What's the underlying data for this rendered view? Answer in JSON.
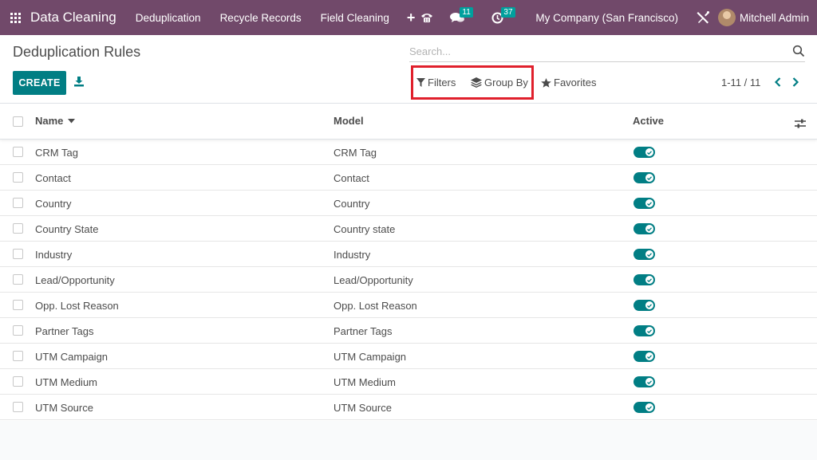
{
  "navbar": {
    "app_title": "Data Cleaning",
    "menu": [
      "Deduplication",
      "Recycle Records",
      "Field Cleaning"
    ],
    "plus_label": "+",
    "messages_count": "11",
    "activities_count": "37",
    "company": "My Company (San Francisco)",
    "user": "Mitchell Admin"
  },
  "control_panel": {
    "title": "Deduplication Rules",
    "search_placeholder": "Search...",
    "create_label": "CREATE",
    "filters_label": "Filters",
    "groupby_label": "Group By",
    "favorites_label": "Favorites",
    "pager": "1-11 / 11"
  },
  "table": {
    "columns": [
      "Name",
      "Model",
      "Active"
    ],
    "rows": [
      {
        "name": "CRM Tag",
        "model": "CRM Tag",
        "active": true
      },
      {
        "name": "Contact",
        "model": "Contact",
        "active": true
      },
      {
        "name": "Country",
        "model": "Country",
        "active": true
      },
      {
        "name": "Country State",
        "model": "Country state",
        "active": true
      },
      {
        "name": "Industry",
        "model": "Industry",
        "active": true
      },
      {
        "name": "Lead/Opportunity",
        "model": "Lead/Opportunity",
        "active": true
      },
      {
        "name": "Opp. Lost Reason",
        "model": "Opp. Lost Reason",
        "active": true
      },
      {
        "name": "Partner Tags",
        "model": "Partner Tags",
        "active": true
      },
      {
        "name": "UTM Campaign",
        "model": "UTM Campaign",
        "active": true
      },
      {
        "name": "UTM Medium",
        "model": "UTM Medium",
        "active": true
      },
      {
        "name": "UTM Source",
        "model": "UTM Source",
        "active": true
      }
    ]
  },
  "colors": {
    "navbar": "#71496a",
    "primary": "#017e84",
    "badge": "#00a09d",
    "highlight": "#e0202c"
  }
}
